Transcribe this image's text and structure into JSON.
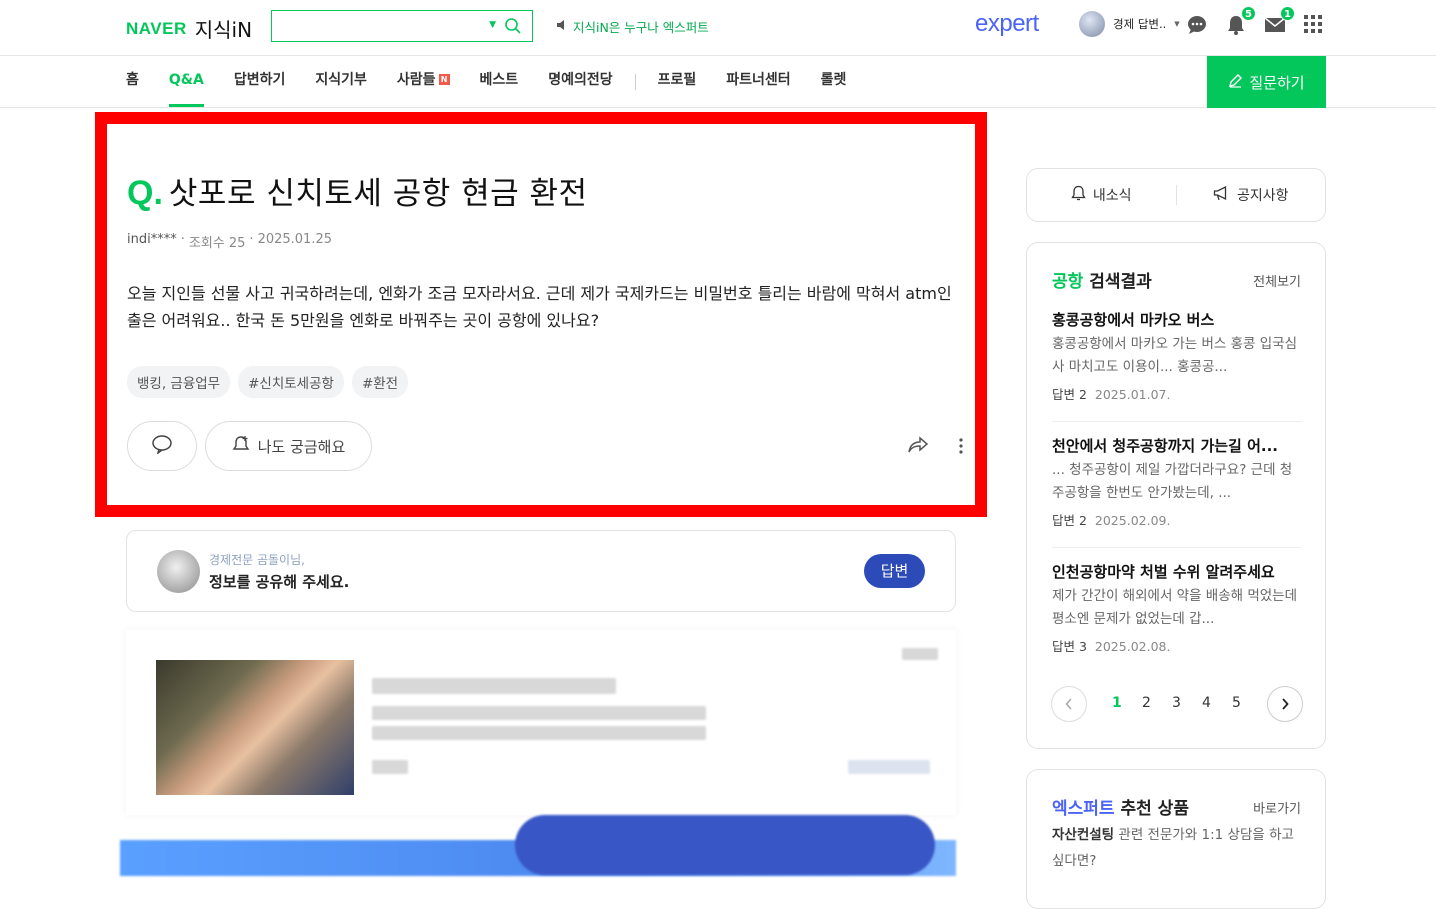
{
  "header": {
    "logo_naver": "NAVER",
    "logo_kin": "지식iN",
    "search_placeholder": "",
    "notice": "지식iN은 누구나 엑스퍼트",
    "expert_logo": "expert",
    "user_name": "경제 답변..",
    "chat_badge": "",
    "alarm_badge": "5",
    "mail_badge": "1"
  },
  "nav": {
    "items": [
      "홈",
      "Q&A",
      "답변하기",
      "지식기부",
      "사람들",
      "베스트",
      "명예의전당",
      "프로필",
      "파트너센터",
      "롤렛"
    ],
    "new_badge": "N",
    "ask_button": "질문하기"
  },
  "question": {
    "mark": "Q.",
    "title": "삿포로 신치토세 공항 현금 환전",
    "author": "indi****",
    "views": "조회수 25",
    "date": "2025.01.25",
    "body": "오늘 지인들 선물 사고 귀국하려는데, 엔화가 조금 모자라서요. 근데 제가 국제카드는 비밀번호 틀리는 바람에 막혀서 atm인출은 어려워요.. 한국 돈 5만원을 엔화로 바꿔주는 곳이 공항에 있나요?",
    "tags": [
      "뱅킹, 금융업무",
      "#신치토세공항",
      "#환전"
    ],
    "curious_label": "나도 궁금해요"
  },
  "answer_prompt": {
    "sub": "경제전문 곰돌이님,",
    "main": "정보를 공유해 주세요.",
    "button": "답변"
  },
  "sidebar": {
    "my_news": "내소식",
    "notices": "공지사항",
    "results": {
      "keyword": "공항",
      "title_suffix": "검색결과",
      "view_all": "전체보기",
      "items": [
        {
          "title": "홍콩공항에서 마카오 버스",
          "desc": "홍콩공항에서 마카오 가는 버스 홍콩 입국심사 마치고도 이용이... 홍콩공...",
          "answers_label": "답변",
          "answers": "2",
          "date": "2025.01.07."
        },
        {
          "title": "천안에서 청주공항까지 가는길 어...",
          "desc": "... 청주공항이 제일 가깝더라구요? 근데 청주공항을 한번도 안가봤는데, ...",
          "answers_label": "답변",
          "answers": "2",
          "date": "2025.02.09."
        },
        {
          "title": "인천공항마약 처벌 수위 알려주세요",
          "desc": "제가 간간이 해외에서 약을 배송해 먹었는데 평소엔 문제가 없었는데 갑...",
          "answers_label": "답변",
          "answers": "3",
          "date": "2025.02.08."
        }
      ],
      "pages": [
        "1",
        "2",
        "3",
        "4",
        "5"
      ],
      "active_page": "1"
    },
    "expert": {
      "keyword": "엑스퍼트",
      "title_suffix": "추천 상품",
      "go": "바로가기",
      "desc_strong": "자산컨설팅",
      "desc_rest": " 관련 전문가와 1:1 상담을 하고 싶다면?"
    }
  },
  "colors": {
    "brand_green": "#03c75a",
    "highlight_red": "#ff0000",
    "expert_blue": "#4b63f6",
    "answer_button": "#2c4bb8"
  }
}
